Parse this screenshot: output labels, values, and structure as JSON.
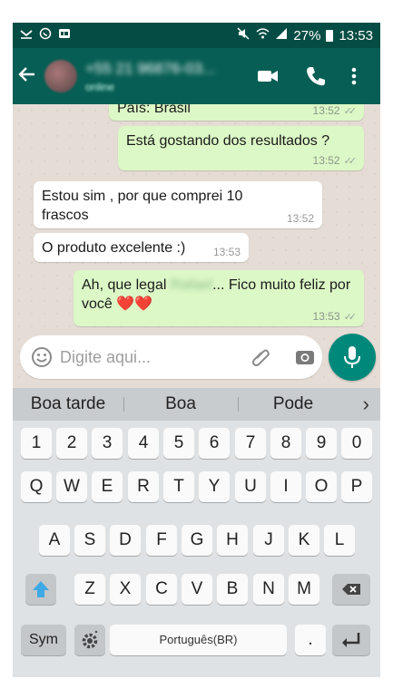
{
  "status_bar": {
    "battery": "27%",
    "time": "13:53"
  },
  "header": {
    "contact_name": "+55 21 96876-03...",
    "contact_status": "online",
    "icons": [
      "back-arrow-icon",
      "avatar",
      "video-call-icon",
      "phone-icon",
      "more-vert-icon"
    ]
  },
  "chat": {
    "messages": [
      {
        "direction": "out",
        "text": "País: Brasil",
        "time": "13:52",
        "ticks": "✓✓"
      },
      {
        "direction": "out",
        "text": "Está gostando dos resultados ?",
        "time": "13:52",
        "ticks": "✓✓"
      },
      {
        "direction": "in",
        "text": "Estou sim , por que comprei 10 frascos",
        "time": "13:52"
      },
      {
        "direction": "in",
        "text": "O produto excelente :)",
        "time": "13:53"
      },
      {
        "direction": "out",
        "text_before": "Ah, que legal ",
        "blurred": "Rafael",
        "text_after": "... Fico muito feliz por você ❤️❤️",
        "time": "13:53",
        "ticks": "✓✓"
      }
    ]
  },
  "composer": {
    "placeholder": "Digite aqui..."
  },
  "keyboard": {
    "suggestions": [
      "Boa tarde",
      "Boa",
      "Pode"
    ],
    "suggest_more": "›",
    "row_numbers": [
      "1",
      "2",
      "3",
      "4",
      "5",
      "6",
      "7",
      "8",
      "9",
      "0"
    ],
    "row1": [
      "Q",
      "W",
      "E",
      "R",
      "T",
      "Y",
      "U",
      "I",
      "O",
      "P"
    ],
    "row2": [
      "A",
      "S",
      "D",
      "F",
      "G",
      "H",
      "J",
      "K",
      "L"
    ],
    "row3": [
      "Z",
      "X",
      "C",
      "V",
      "B",
      "N",
      "M"
    ],
    "sym_label": "Sym",
    "space_label": "Português(BR)",
    "period_label": ".",
    "colors": {
      "shift_arrow": "#3fa9e6"
    }
  },
  "colors": {
    "status_bar": "#054d44",
    "app_bar": "#075e54",
    "outgoing_bubble": "#dcf8c6",
    "incoming_bubble": "#ffffff",
    "mic_button": "#00897b"
  }
}
